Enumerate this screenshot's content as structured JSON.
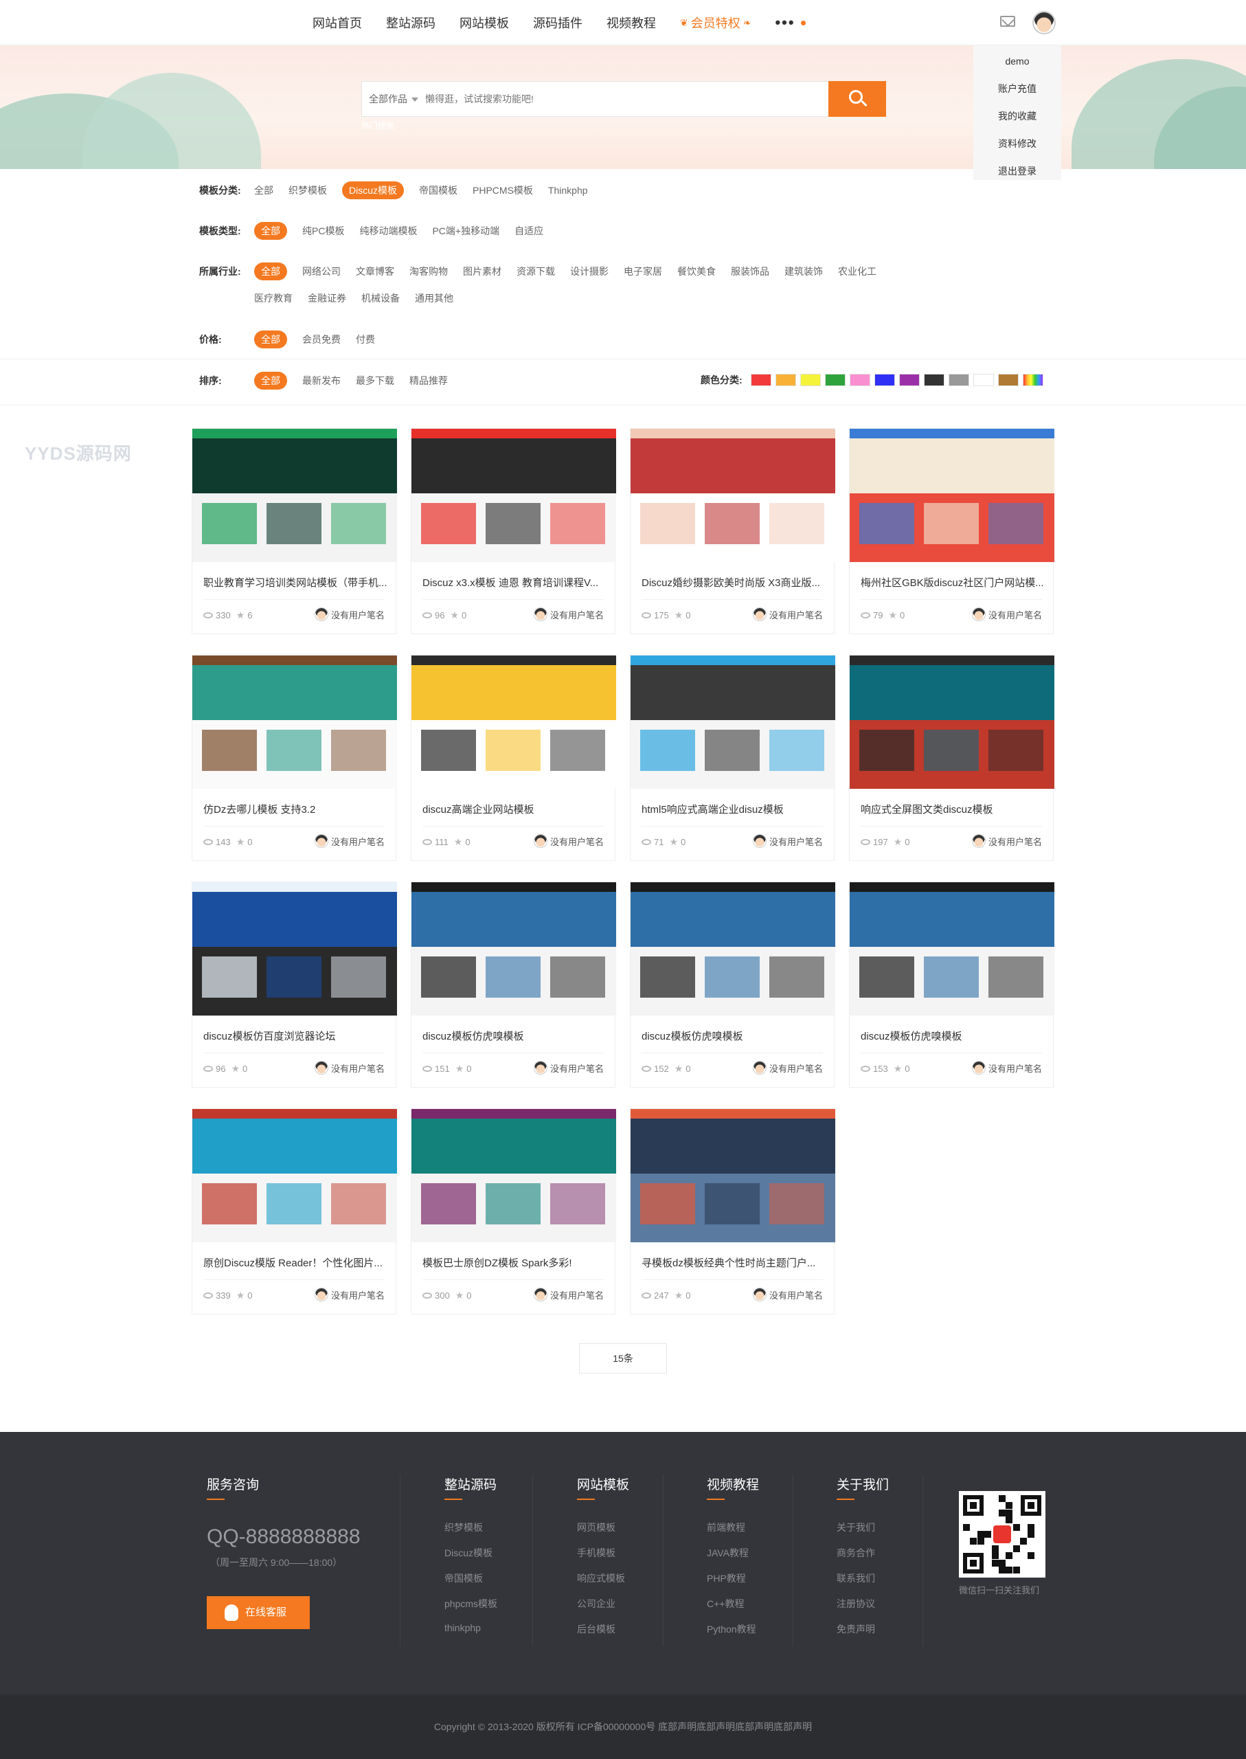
{
  "nav": {
    "items": [
      "网站首页",
      "整站源码",
      "网站模板",
      "源码插件",
      "视频教程"
    ],
    "vip": "会员特权",
    "more": "•••"
  },
  "user_menu": [
    "demo",
    "账户充值",
    "我的收藏",
    "资料修改",
    "退出登录"
  ],
  "search": {
    "category": "全部作品",
    "placeholder": "懒得逛，试试搜索功能吧!",
    "hot": "热门搜索"
  },
  "filters": {
    "category": {
      "label": "模板分类:",
      "options": [
        "全部",
        "织梦模板",
        "Discuz模板",
        "帝国模板",
        "PHPCMS模板",
        "Thinkphp"
      ],
      "active": 2
    },
    "type": {
      "label": "模板类型:",
      "options": [
        "全部",
        "纯PC模板",
        "纯移动端模板",
        "PC端+独移动端",
        "自适应"
      ],
      "active": 0
    },
    "industry": {
      "label": "所属行业:",
      "row1": [
        "全部",
        "网络公司",
        "文章博客",
        "淘客购物",
        "图片素材",
        "资源下载",
        "设计摄影",
        "电子家居",
        "餐饮美食",
        "服装饰品",
        "建筑装饰",
        "农业化工"
      ],
      "row2": [
        "医疗教育",
        "金融证券",
        "机械设备",
        "通用其他"
      ],
      "active": 0
    },
    "price": {
      "label": "价格:",
      "options": [
        "全部",
        "会员免费",
        "付费"
      ],
      "active": 0
    },
    "sort": {
      "label": "排序:",
      "options": [
        "全部",
        "最新发布",
        "最多下载",
        "精品推荐"
      ],
      "active": 0
    },
    "colors": {
      "label": "颜色分类:",
      "swatches": [
        "#f23a3a",
        "#f8b135",
        "#f5f23a",
        "#2fa33b",
        "#f98fd0",
        "#2f2ff5",
        "#9b2fa8",
        "#333333",
        "#999999",
        "#ffffff",
        "#b07a34",
        "rainbow"
      ]
    }
  },
  "watermark": "YYDS源码网",
  "cards": [
    {
      "title": "职业教育学习培训类网站模板（带手机...",
      "views": "330",
      "stars": "6",
      "author": "没有用户笔名"
    },
    {
      "title": "Discuz x3.x模板 迪恩 教育培训课程V...",
      "views": "96",
      "stars": "0",
      "author": "没有用户笔名"
    },
    {
      "title": "Discuz婚纱摄影欧美时尚版 X3商业版...",
      "views": "175",
      "stars": "0",
      "author": "没有用户笔名"
    },
    {
      "title": "梅州社区GBK版discuz社区门户网站模...",
      "views": "79",
      "stars": "0",
      "author": "没有用户笔名"
    },
    {
      "title": "仿Dz去哪儿模板 支持3.2",
      "views": "143",
      "stars": "0",
      "author": "没有用户笔名"
    },
    {
      "title": "discuz高端企业网站模板",
      "views": "111",
      "stars": "0",
      "author": "没有用户笔名"
    },
    {
      "title": "html5响应式高端企业disuz模板",
      "views": "71",
      "stars": "0",
      "author": "没有用户笔名"
    },
    {
      "title": "响应式全屏图文类discuz模板",
      "views": "197",
      "stars": "0",
      "author": "没有用户笔名"
    },
    {
      "title": "discuz模板仿百度浏览器论坛",
      "views": "96",
      "stars": "0",
      "author": "没有用户笔名"
    },
    {
      "title": "discuz模板仿虎嗅模板",
      "views": "151",
      "stars": "0",
      "author": "没有用户笔名"
    },
    {
      "title": "discuz模板仿虎嗅模板",
      "views": "152",
      "stars": "0",
      "author": "没有用户笔名"
    },
    {
      "title": "discuz模板仿虎嗅模板",
      "views": "153",
      "stars": "0",
      "author": "没有用户笔名"
    },
    {
      "title": "原创Discuz模版 Reader！个性化图片...",
      "views": "339",
      "stars": "0",
      "author": "没有用户笔名"
    },
    {
      "title": "模板巴士原创DZ模板 Spark多彩!",
      "views": "300",
      "stars": "0",
      "author": "没有用户笔名"
    },
    {
      "title": "寻模板dz模板经典个性时尚主题门户...",
      "views": "247",
      "stars": "0",
      "author": "没有用户笔名"
    }
  ],
  "pager": "15条",
  "footer": {
    "service": {
      "title": "服务咨询",
      "qq": "QQ-8888888888",
      "hours": "（周一至周六 9:00——18:00）",
      "button": "在线客服"
    },
    "columns": [
      {
        "title": "整站源码",
        "links": [
          "织梦模板",
          "Discuz模板",
          "帝国模板",
          "phpcms模板",
          "thinkphp"
        ]
      },
      {
        "title": "网站模板",
        "links": [
          "网页模板",
          "手机模板",
          "响应式模板",
          "公司企业",
          "后台模板"
        ]
      },
      {
        "title": "视频教程",
        "links": [
          "前端教程",
          "JAVA教程",
          "PHP教程",
          "C++教程",
          "Python教程"
        ]
      },
      {
        "title": "关于我们",
        "links": [
          "关于我们",
          "商务合作",
          "联系我们",
          "注册协议",
          "免责声明"
        ]
      }
    ],
    "qr_caption": "微信扫一扫关注我们",
    "copyright": "Copyright © 2013-2020 版权所有 ICP备00000000号 底部声明底部声明底部声明底部声明"
  }
}
